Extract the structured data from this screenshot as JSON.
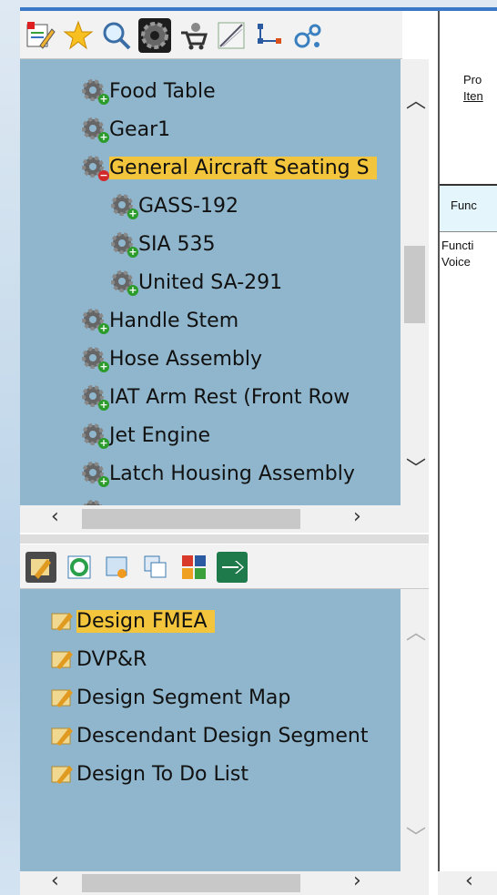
{
  "tree": {
    "items": [
      {
        "label": "Food Table",
        "state": "collapsed"
      },
      {
        "label": "Gear1",
        "state": "collapsed"
      },
      {
        "label": "General Aircraft Seating S",
        "state": "expanded"
      },
      {
        "label": "GASS-192",
        "state": "collapsed"
      },
      {
        "label": "SIA 535",
        "state": "collapsed"
      },
      {
        "label": "United SA-291",
        "state": "collapsed"
      },
      {
        "label": "Handle Stem",
        "state": "collapsed"
      },
      {
        "label": "Hose Assembly",
        "state": "collapsed"
      },
      {
        "label": "IAT Arm Rest (Front Row",
        "state": "collapsed"
      },
      {
        "label": "Jet Engine",
        "state": "collapsed"
      },
      {
        "label": "Latch Housing Assembly",
        "state": "collapsed"
      }
    ]
  },
  "toolbar_icons": [
    "edit-icon",
    "favorites-star-icon",
    "search-icon",
    "gear-icon",
    "cart-icon",
    "measure-icon",
    "flowchart-icon",
    "molecule-icon"
  ],
  "toolbar2_icons": [
    "design-icon",
    "refresh-icon",
    "certificate-icon",
    "copy-icon",
    "matrix-icon",
    "plane-icon"
  ],
  "documents": {
    "items": [
      {
        "label": "Design FMEA"
      },
      {
        "label": "DVP&R"
      },
      {
        "label": "Design Segment Map"
      },
      {
        "label": "Descendant Design Segment"
      },
      {
        "label": "Design To Do List"
      }
    ]
  },
  "right_panel": {
    "line1": "Pro",
    "line2": "Iten",
    "band": "Func",
    "line3": "Functi",
    "line4": "Voice"
  },
  "colors": {
    "tree_bg": "#8fb6cc",
    "selected": "#f3c53c",
    "accent": "#3a78c8"
  }
}
